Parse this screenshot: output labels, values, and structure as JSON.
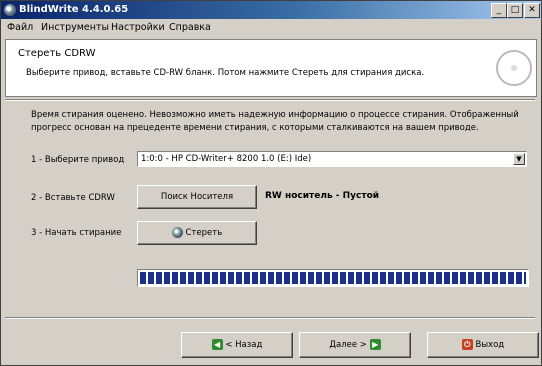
{
  "window": {
    "title": "BlindWrite 4.4.0.65"
  },
  "menu": [
    "Файл",
    "Инструменты",
    "Настройки",
    "Справка"
  ],
  "header": {
    "title": "Стереть CDRW",
    "subtitle": "Выберите привод, вставьте CD-RW бланк. Потом нажмите Стереть для стирания диска."
  },
  "info_text": "Время стирания оценено. Невозможно иметь надежную информацию о процессе стирания. Отображенный прогресс основан на прецеденте времени стирания, с которыми сталкиваются на вашем приводе.",
  "steps": {
    "select_drive_label": "1 - Выберите привод",
    "drive_value": "1:0:0 - HP CD-Writer+ 8200 1.0 (E:) Ide)",
    "insert_label": "2 - Вставьте CDRW",
    "search_button": "Поиск Носителя",
    "media_status": "RW носитель - Пустой",
    "start_label": "3 - Начать стирание",
    "erase_button": "Стереть"
  },
  "progress": {
    "fraction": 1.0
  },
  "footer": {
    "back_button": "< Назад",
    "next_button": "Далее >",
    "exit_button": "Выход"
  },
  "colors": {
    "titlebar": "#0a246a",
    "progress": "#1a2f8a",
    "back_icon": "#2e8b2e",
    "exit_icon": "#c8401e"
  }
}
